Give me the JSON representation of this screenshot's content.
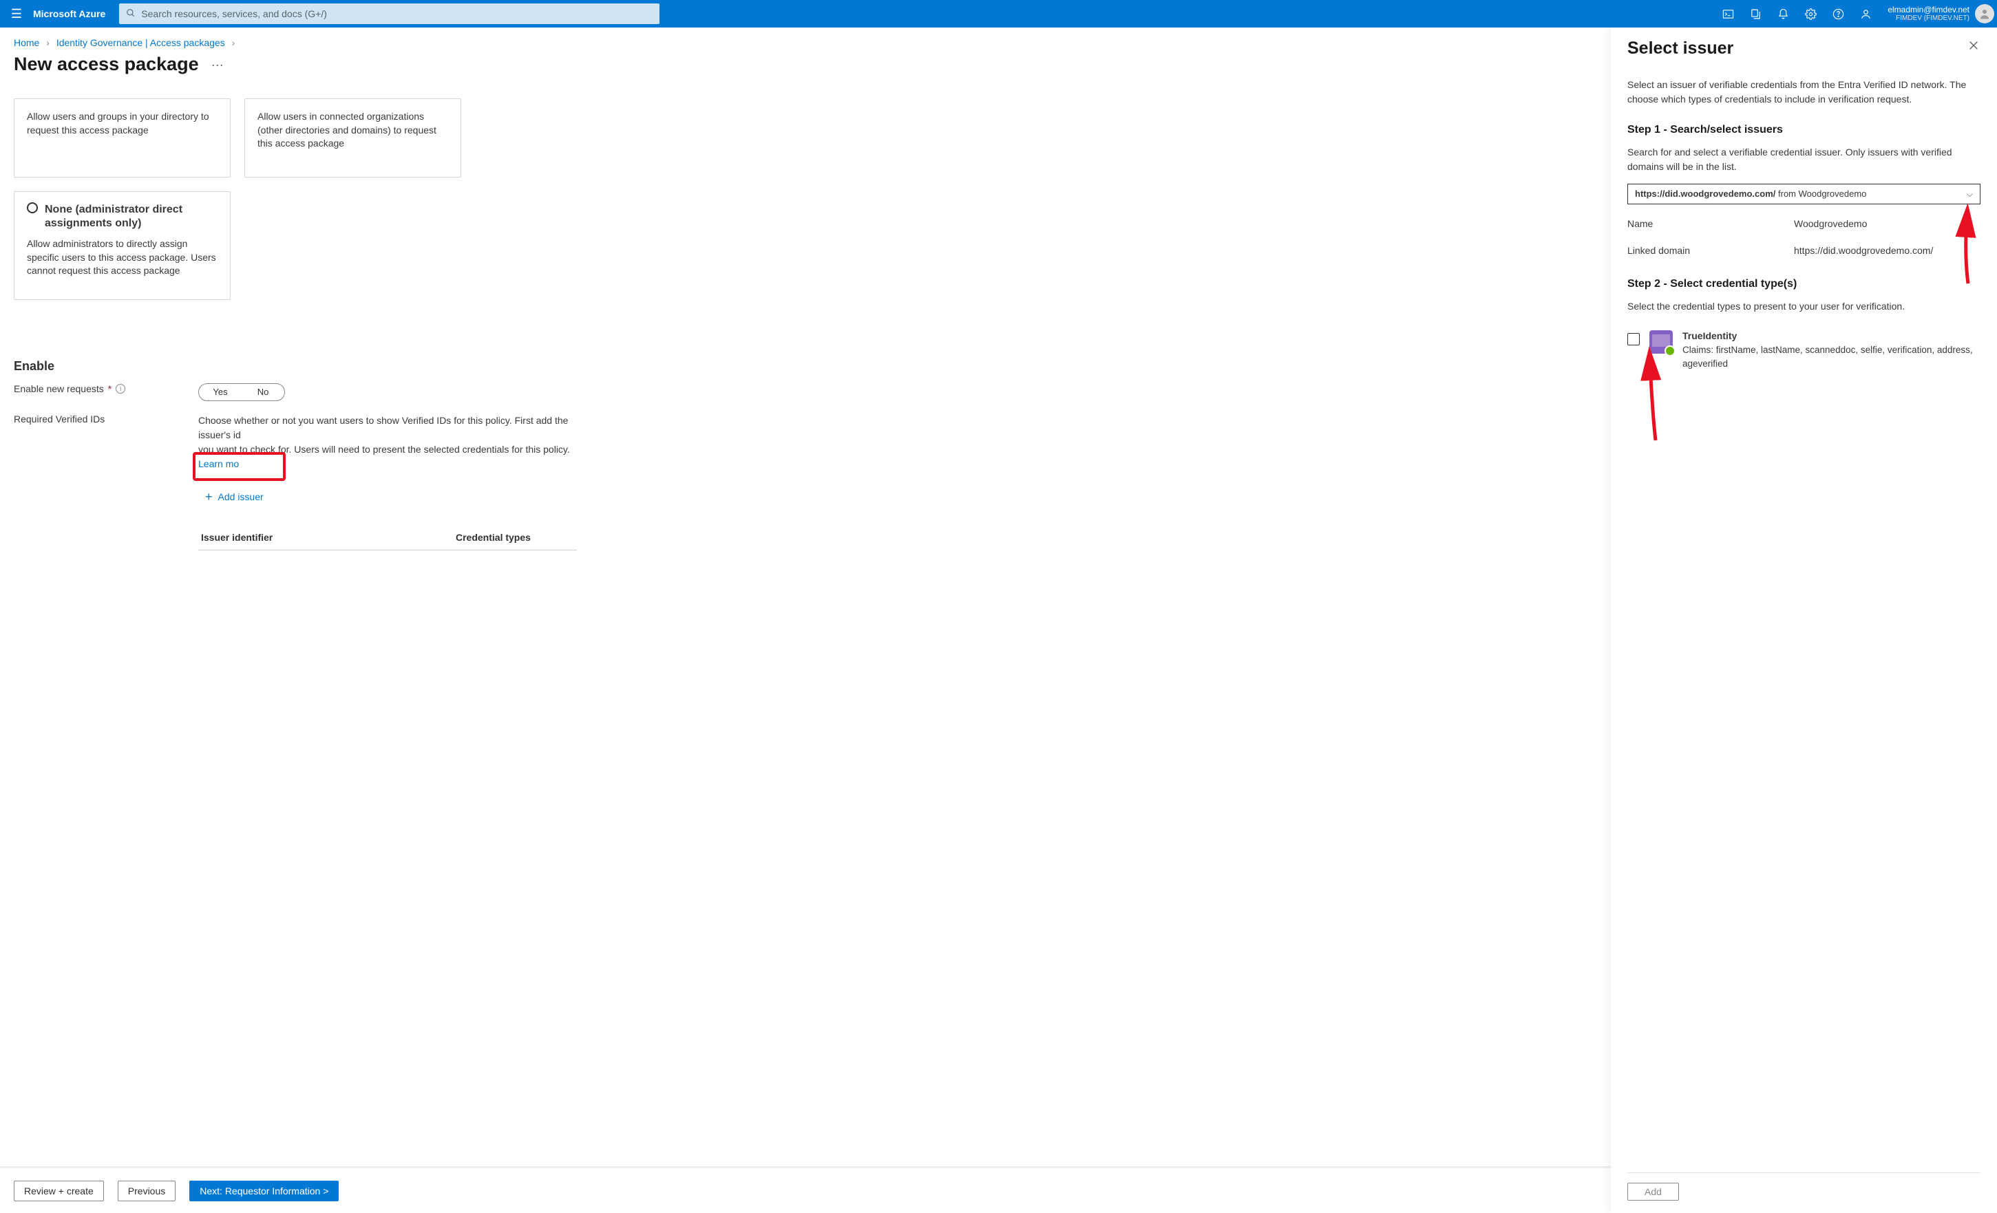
{
  "top": {
    "brand": "Microsoft Azure",
    "search_placeholder": "Search resources, services, and docs (G+/)",
    "user_email": "elmadmin@fimdev.net",
    "user_tenant": "FIMDEV (FIMDEV.NET)"
  },
  "breadcrumbs": {
    "home": "Home",
    "ig": "Identity Governance | Access packages"
  },
  "page_title": "New access package",
  "cards": {
    "c1": "Allow users and groups in your directory to request this access package",
    "c2": "Allow users in connected organizations (other directories and domains) to request this access package",
    "c3_title": "None (administrator direct assignments only)",
    "c3_body": "Allow administrators to directly assign specific users to this access package. Users cannot request this access package"
  },
  "enable": {
    "heading": "Enable",
    "new_requests_label": "Enable new requests",
    "yes": "Yes",
    "no": "No",
    "verified_label": "Required Verified IDs",
    "verified_desc1": "Choose whether or not you want users to show Verified IDs for this policy. First add the issuer's id",
    "verified_desc2": "you want to check for. Users will need to present the selected credentials for this policy. ",
    "learn_more": "Learn mo",
    "add_issuer": "Add issuer",
    "col1": "Issuer identifier",
    "col2": "Credential types"
  },
  "footer": {
    "review": "Review + create",
    "previous": "Previous",
    "next": "Next: Requestor Information >"
  },
  "panel": {
    "title": "Select issuer",
    "desc": "Select an issuer of verifiable credentials from the Entra Verified ID network. The choose which types of credentials to include in verification request.",
    "step1_h": "Step 1 - Search/select issuers",
    "step1_desc": "Search for and select a verifiable credential issuer. Only issuers with verified domains will be in the list.",
    "dropdown_bold": "https://did.woodgrovedemo.com/",
    "dropdown_rest": " from  Woodgrovedemo",
    "name_label": "Name",
    "name_value": "Woodgrovedemo",
    "domain_label": "Linked domain",
    "domain_value": "https://did.woodgrovedemo.com/",
    "step2_h": "Step 2 - Select credential type(s)",
    "step2_desc": "Select the credential types to present to your user for verification.",
    "cred_title": "TrueIdentity",
    "cred_claims": "Claims: firstName, lastName, scanneddoc, selfie, verification, address, ageverified",
    "add_btn": "Add"
  }
}
